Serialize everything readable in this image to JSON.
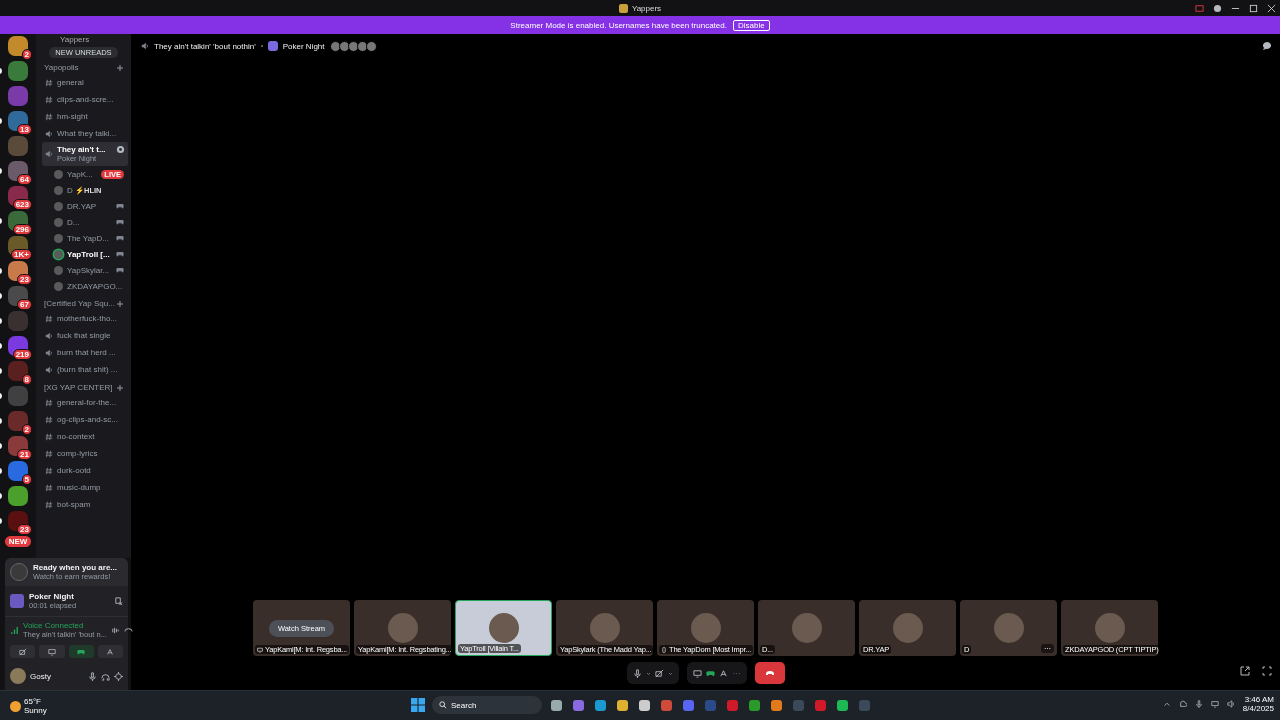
{
  "window": {
    "title": "Yappers"
  },
  "banner": {
    "message": "Streamer Mode is enabled. Usernames have been truncated.",
    "button": "Disable"
  },
  "servers": [
    {
      "badge": "2",
      "unread": false
    },
    {
      "unread": true
    },
    {
      "unread": false
    },
    {
      "badge": "13",
      "unread": true
    },
    {
      "unread": false
    },
    {
      "badge": "64",
      "unread": true
    },
    {
      "badge": "623",
      "unread": false
    },
    {
      "badge": "296",
      "unread": true
    },
    {
      "badge": "1K+",
      "unread": false
    },
    {
      "badge": "23",
      "unread": true
    },
    {
      "badge": "67",
      "unread": true
    },
    {
      "unread": true
    },
    {
      "badge": "219",
      "unread": true
    },
    {
      "badge": "8",
      "unread": true
    },
    {
      "unread": true
    },
    {
      "badge": "2",
      "unread": true
    },
    {
      "badge": "21",
      "unread": true
    },
    {
      "badge": "5",
      "unread": true
    },
    {
      "unread": true
    },
    {
      "badge": "23",
      "unread": true
    }
  ],
  "servers_new": "NEW",
  "channel_sidebar": {
    "server_name": "Yappers",
    "new_unreads": "NEW UNREADS",
    "categories": [
      {
        "name": "Yapopolis",
        "channels": [
          {
            "kind": "text",
            "name": "general",
            "selected": false
          },
          {
            "kind": "text",
            "name": "clips-and-scre...",
            "selected": false
          },
          {
            "kind": "text",
            "name": "hm-sight",
            "selected": false
          },
          {
            "kind": "voice",
            "name": "What they talki...",
            "selected": false
          },
          {
            "kind": "voice",
            "name": "They ain't t...",
            "selected": true,
            "subtitle": "Poker Night",
            "members": [
              {
                "name": "YapK...",
                "live": "LIVE",
                "speaking": false,
                "activity": false
              },
              {
                "name": "D",
                "tag": "⚡HLIN",
                "speaking": false,
                "activity": false
              },
              {
                "name": "DR.YAP",
                "speaking": false,
                "activity": true
              },
              {
                "name": "D...",
                "speaking": false,
                "activity": true
              },
              {
                "name": "The YapD...",
                "speaking": false,
                "activity": true
              },
              {
                "name": "YapTroll [...",
                "speaking": true,
                "activity": true
              },
              {
                "name": "YapSkylar...",
                "speaking": false,
                "activity": true
              },
              {
                "name": "ZKDAYAPGO...",
                "speaking": false,
                "activity": false
              }
            ]
          }
        ]
      },
      {
        "name": "[Certified Yap Squ...",
        "channels": [
          {
            "kind": "text",
            "name": "motherfuck-tho...",
            "selected": false
          },
          {
            "kind": "voice",
            "name": "fuck that single",
            "selected": false
          },
          {
            "kind": "voice",
            "name": "burn that herd ...",
            "selected": false
          },
          {
            "kind": "voice",
            "name": "(burn that shit) ...",
            "selected": false
          }
        ]
      },
      {
        "name": "[XG YAP CENTER]",
        "channels": [
          {
            "kind": "text",
            "name": "general-for-the...",
            "selected": false
          },
          {
            "kind": "text",
            "name": "og-clips-and-sc...",
            "selected": false
          },
          {
            "kind": "text",
            "name": "no-context",
            "selected": false
          },
          {
            "kind": "text",
            "name": "comp-lyrics",
            "selected": false
          },
          {
            "kind": "text",
            "name": "durk-ootd",
            "selected": false
          },
          {
            "kind": "text",
            "name": "music-dump",
            "selected": false
          },
          {
            "kind": "text",
            "name": "bot-spam",
            "selected": false
          }
        ]
      }
    ]
  },
  "user_area": {
    "promo": {
      "title": "Ready when you are...",
      "subtitle": "Watch to earn rewards!"
    },
    "activity": {
      "title": "Poker Night",
      "subtitle": "00:01 elapsed"
    },
    "voice": {
      "status": "Voice Connected",
      "channel": "They ain't talkin' 'bout n..."
    },
    "user": {
      "name": "Gosty"
    }
  },
  "header": {
    "channel": "They ain't talkin' 'bout nothin'",
    "activity": "Poker Night"
  },
  "tiles": [
    {
      "kind": "screen",
      "label": "YapKami[M: Int. Regsba...",
      "button": "Watch Stream",
      "selected": false
    },
    {
      "kind": "plain",
      "label": "YapKami[M: Int. Regsbating...",
      "selected": false
    },
    {
      "kind": "plain",
      "label": "YapTroll [Villain T...",
      "selected": true
    },
    {
      "kind": "plain",
      "label": "YapSkylark (The Madd Yap...",
      "selected": false
    },
    {
      "kind": "mobile",
      "label": "The YapDom [Most Impr...",
      "selected": false
    },
    {
      "kind": "plain",
      "label": "D...",
      "selected": false
    },
    {
      "kind": "plain",
      "label": "DR.YAP",
      "selected": false
    },
    {
      "kind": "plain",
      "label": "D",
      "menu": "⋯",
      "selected": false
    },
    {
      "kind": "plain",
      "label": "ZKDAYAPGOD (CPT TIPTIP)",
      "selected": false
    }
  ],
  "controls": {
    "camera_on": false
  },
  "taskbar": {
    "weather": {
      "temp": "65°F",
      "condition": "Sunny"
    },
    "search": {
      "placeholder": "Search"
    },
    "apps": [
      {
        "kind": "taskview"
      },
      {
        "kind": "copilot"
      },
      {
        "kind": "edge"
      },
      {
        "kind": "folder"
      },
      {
        "kind": "notepad"
      },
      {
        "kind": "chrome"
      },
      {
        "kind": "discord"
      },
      {
        "kind": "steam"
      },
      {
        "kind": "opera"
      },
      {
        "kind": "xbox"
      },
      {
        "kind": "vlc"
      },
      {
        "kind": "terminal"
      },
      {
        "kind": "opera"
      },
      {
        "kind": "spotify"
      },
      {
        "kind": "terminal"
      }
    ],
    "time": "3:46 AM",
    "date": "8/4/2025"
  }
}
